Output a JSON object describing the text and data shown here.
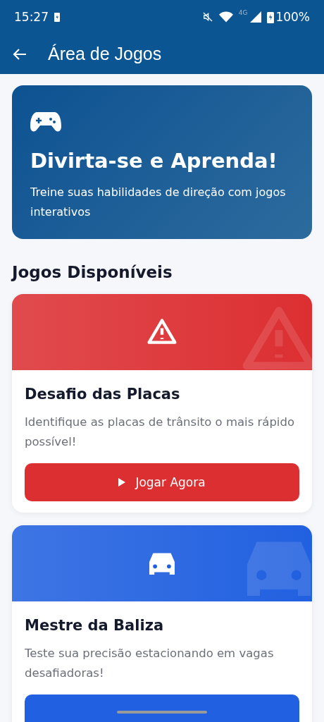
{
  "status_bar": {
    "time": "15:27",
    "network": "4G",
    "battery": "100%"
  },
  "app_bar": {
    "title": "Área de Jogos"
  },
  "hero": {
    "title": "Divirta-se e Aprenda!",
    "subtitle": "Treine suas habilidades de direção com jogos interativos"
  },
  "section_title": "Jogos Disponíveis",
  "games": [
    {
      "kind": "signs",
      "color": "#dc2f32",
      "title": "Desafio das Placas",
      "description": "Identifique as placas de trânsito o mais rápido possível!",
      "button_label": "Jogar Agora"
    },
    {
      "kind": "parking",
      "color": "#2160e0",
      "title": "Mestre da Baliza",
      "description": "Teste sua precisão estacionando em vagas desafiadoras!"
    }
  ]
}
